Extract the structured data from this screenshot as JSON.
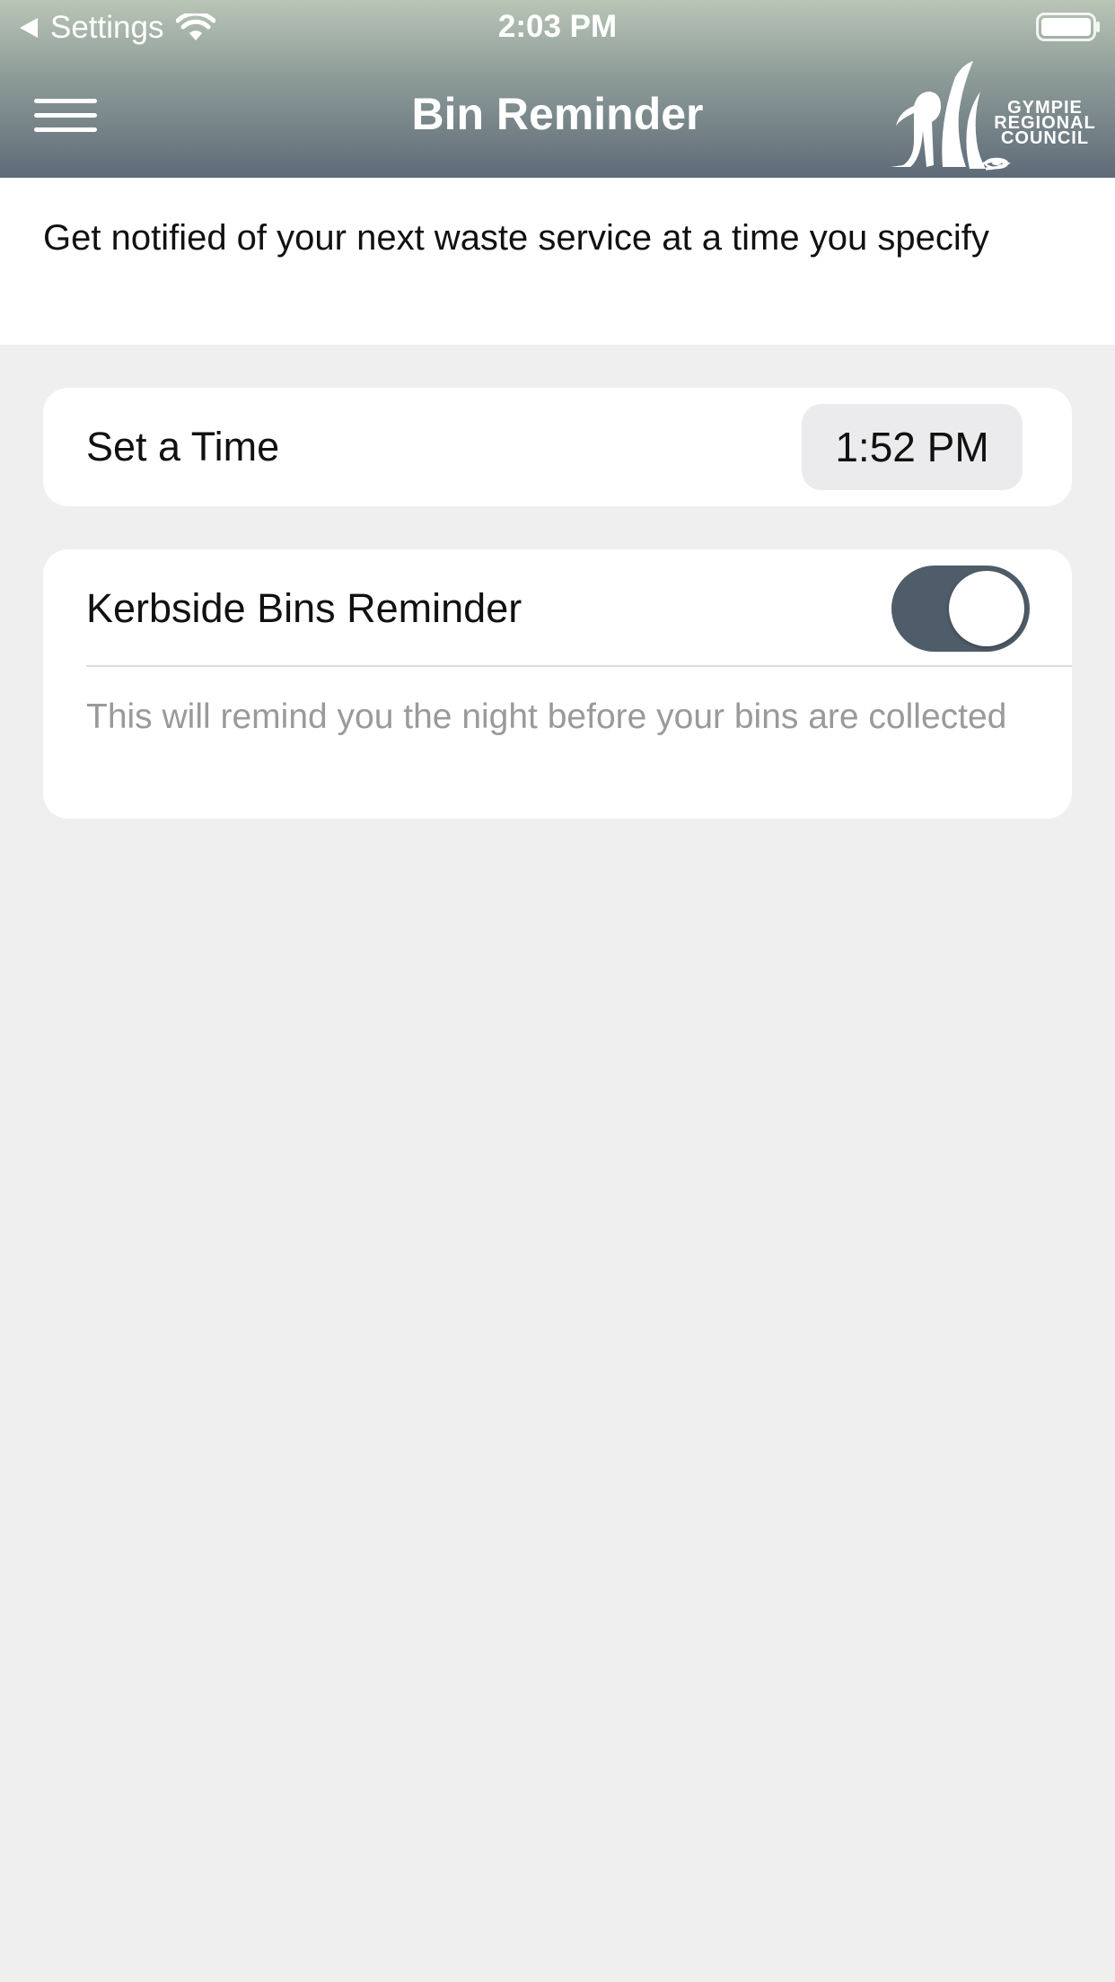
{
  "status_bar": {
    "back_label": "Settings",
    "time": "2:03 PM"
  },
  "nav": {
    "title": "Bin Reminder",
    "logo_lines": [
      "GYMPIE",
      "REGIONAL",
      "COUNCIL"
    ]
  },
  "description": "Get notified of your next waste service at a time you specify",
  "time_setting": {
    "label": "Set a Time",
    "value": "1:52 PM"
  },
  "kerbside_reminder": {
    "label": "Kerbside Bins Reminder",
    "enabled": true,
    "note": "This will remind you the night before your bins are collected"
  },
  "colors": {
    "toggle_on": "#4f5c69",
    "header_top": "#b9c5b6",
    "header_bottom": "#5e6b78",
    "background": "#efefef"
  },
  "icons": [
    "back-triangle-icon",
    "wifi-icon",
    "battery-icon",
    "menu-icon",
    "council-logo-icon"
  ]
}
